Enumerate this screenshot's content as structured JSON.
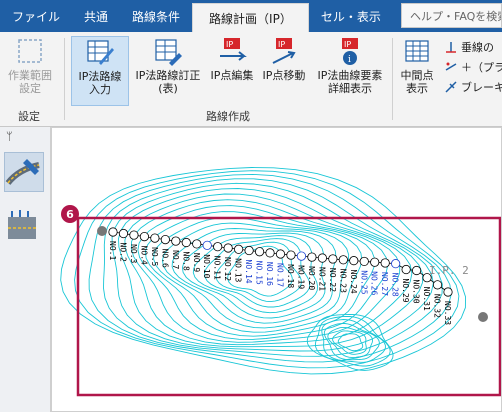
{
  "tabs": [
    "ファイル",
    "共通",
    "路線条件",
    "路線計画（IP）",
    "セル・表示"
  ],
  "active_tab_index": 3,
  "help_search": {
    "placeholder": "ヘルプ・FAQを検索"
  },
  "ribbon": {
    "settings_button": {
      "line1": "作業範囲",
      "line2": "設定"
    },
    "ip_route_input": {
      "line1": "IP法路線",
      "line2": "入力"
    },
    "ip_route_edit_table": {
      "line1": "IP法路線訂正",
      "line2": "(表)"
    },
    "ip_point_edit": {
      "line1": "IP点編集"
    },
    "ip_point_move": {
      "line1": "IP点移動"
    },
    "ip_curve_detail": {
      "line1": "IP法曲線要素",
      "line2": "詳細表示"
    },
    "midpoint_display": {
      "line1": "中間点",
      "line2": "表示"
    },
    "small_items": [
      "垂線の",
      "＋（プラ",
      "ブレーキ"
    ],
    "group_settings": "設定",
    "group_route": "路線作成"
  },
  "canvas": {
    "callout_number": "6",
    "ip_label": "I.P. 2",
    "station_labels": [
      "NO.1",
      "NO.2",
      "NO.3",
      "NO.4",
      "NO.5",
      "NO.6",
      "NO.7",
      "NO.8",
      "NO.9",
      "NO.10",
      "NO.11",
      "NO.12",
      "NO.13",
      "NO.14",
      "NO.15",
      "NO.16",
      "NO.17",
      "NO.18",
      "NO.19",
      "NO.20",
      "NO.21",
      "NO.22",
      "NO.23",
      "NO.24",
      "NO.25",
      "NO.26",
      "NO.27",
      "NO.28",
      "NO.29",
      "NO.30",
      "NO.31",
      "NO.32",
      "NO.33"
    ]
  },
  "colors": {
    "tabbar": "#1f5fa5",
    "contour": "#19c6d6",
    "highlight": "#b0164a",
    "station_blue": "#1b3fd1"
  },
  "icons": [
    "lightbulb-icon",
    "dashed-rect-icon",
    "route-pencil-icon",
    "table-edit-icon",
    "ip-edit-icon",
    "ip-move-icon",
    "ip-info-icon",
    "grid-table-icon",
    "perpendicular-icon",
    "plus-icon",
    "brake-icon",
    "pin-icon",
    "route-draw-icon",
    "road-view-icon"
  ]
}
